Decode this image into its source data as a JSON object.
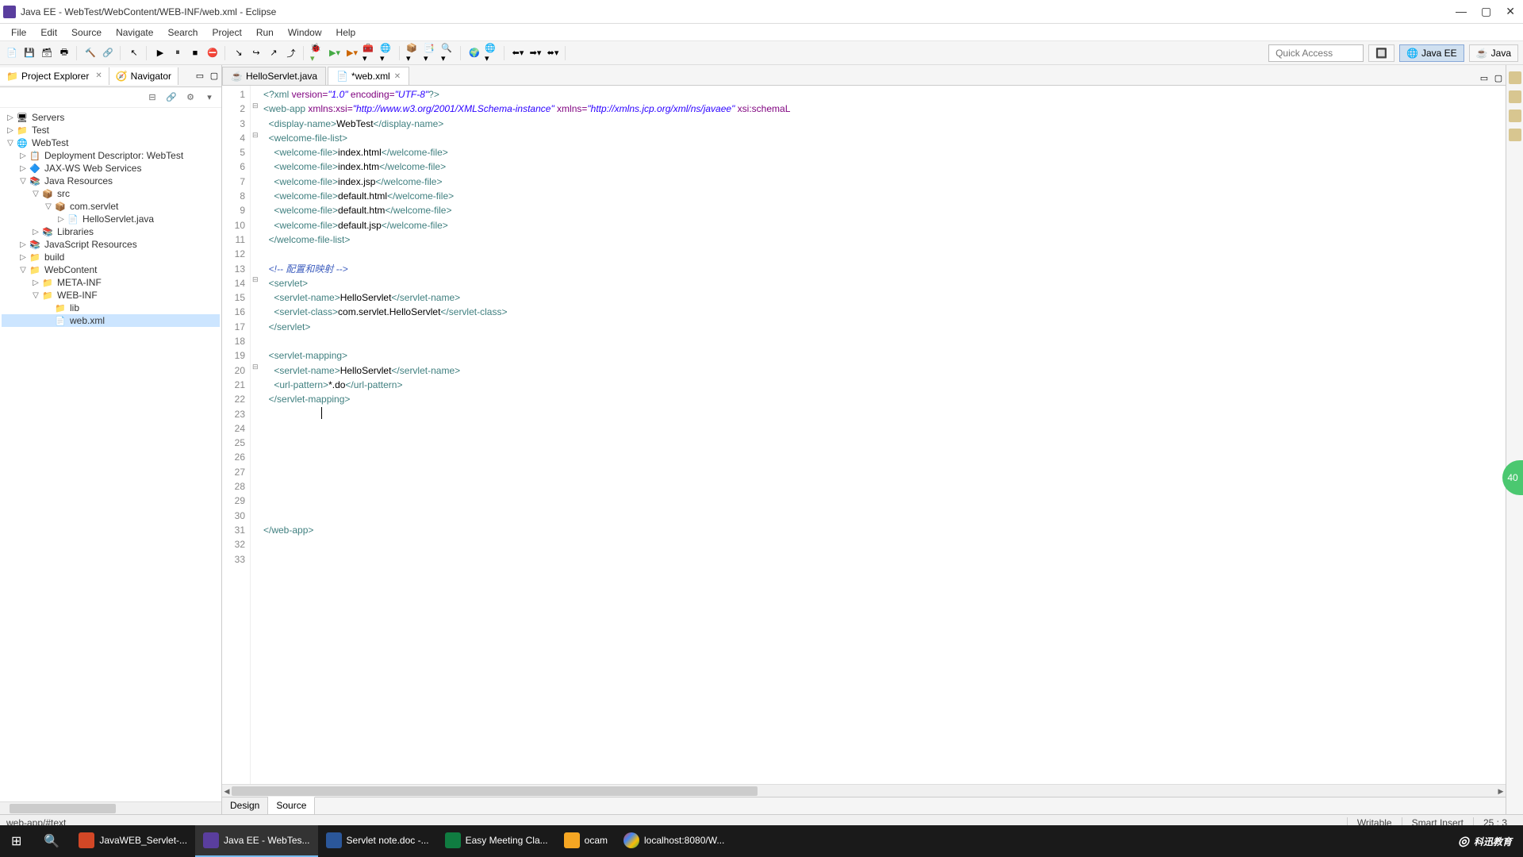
{
  "window": {
    "title": "Java EE - WebTest/WebContent/WEB-INF/web.xml - Eclipse"
  },
  "menu": [
    "File",
    "Edit",
    "Source",
    "Navigate",
    "Search",
    "Project",
    "Run",
    "Window",
    "Help"
  ],
  "quick_access_placeholder": "Quick Access",
  "perspectives": {
    "javaee": "Java EE",
    "java": "Java"
  },
  "views": {
    "project_explorer": "Project Explorer",
    "navigator": "Navigator"
  },
  "tree": {
    "servers": "Servers",
    "test": "Test",
    "webtest": "WebTest",
    "dd": "Deployment Descriptor: WebTest",
    "jaxws": "JAX-WS Web Services",
    "javares": "Java Resources",
    "src": "src",
    "comservlet": "com.servlet",
    "hellojava": "HelloServlet.java",
    "libraries": "Libraries",
    "jsres": "JavaScript Resources",
    "build": "build",
    "webcontent": "WebContent",
    "metainf": "META-INF",
    "webinf": "WEB-INF",
    "lib": "lib",
    "webxml": "web.xml"
  },
  "tabs": {
    "hello": "HelloServlet.java",
    "webxml": "*web.xml"
  },
  "code": {
    "l1": {
      "open": "<?xml",
      "attrs": " version=",
      "v1": "\"1.0\"",
      "enc": " encoding=",
      "v2": "\"UTF-8\"",
      "close": "?>"
    },
    "l2": {
      "open": "<web-app",
      "a1": " xmlns:xsi=",
      "v1": "\"http://www.w3.org/2001/XMLSchema-instance\"",
      "a2": " xmlns=",
      "v2": "\"http://xmlns.jcp.org/xml/ns/javaee\"",
      "a3": " xsi:schemaL"
    },
    "l3": {
      "o": "<display-name>",
      "t": "WebTest",
      "c": "</display-name>"
    },
    "l4": "<welcome-file-list>",
    "wf": {
      "o": "<welcome-file>",
      "c": "</welcome-file>"
    },
    "wf1": "index.html",
    "wf2": "index.htm",
    "wf3": "index.jsp",
    "wf4": "default.html",
    "wf5": "default.htm",
    "wf6": "default.jsp",
    "l11": "</welcome-file-list>",
    "l13": "<!-- 配置和映射 -->",
    "l14": "<servlet>",
    "sn": {
      "o": "<servlet-name>",
      "t": "HelloServlet",
      "c": "</servlet-name>"
    },
    "sc": {
      "o": "<servlet-class>",
      "t": "com.servlet.HelloServlet",
      "c": "</servlet-class>"
    },
    "l17": "</servlet>",
    "l19": "<servlet-mapping>",
    "up": {
      "o": "<url-pattern>",
      "t": "*.do",
      "c": "</url-pattern>"
    },
    "l22": "</servlet-mapping>",
    "l33": "</web-app>"
  },
  "bottom_tabs": {
    "design": "Design",
    "source": "Source"
  },
  "status": {
    "path": "web-app/#text",
    "writable": "Writable",
    "insert": "Smart Insert",
    "pos": "25 : 3"
  },
  "taskbar": {
    "i1": "JavaWEB_Servlet-...",
    "i2": "Java EE - WebTes...",
    "i3": "Servlet note.doc -...",
    "i4": "Easy Meeting Cla...",
    "i5": "ocam",
    "i6": "localhost:8080/W...",
    "brand": "科迅教育",
    "badge": "40"
  }
}
